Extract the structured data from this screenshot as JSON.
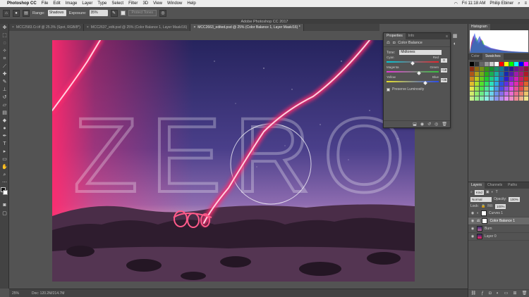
{
  "menubar": {
    "app_name": "Photoshop CC",
    "items": [
      "File",
      "Edit",
      "Image",
      "Layer",
      "Type",
      "Select",
      "Filter",
      "3D",
      "View",
      "Window",
      "Help"
    ],
    "clock": "Fri 11:18 AM",
    "user": "Philip Ebiner"
  },
  "options": {
    "range_label": "Range:",
    "range_value": "Shadows",
    "exposure_label": "Exposure:",
    "exposure_value": "35%",
    "protect_tones_label": "Protect Tones"
  },
  "window": {
    "title": "Adobe Photoshop CC 2017"
  },
  "doc_tabs": [
    {
      "label": "MCC2583.Cr.tif @ 25.3% (Spot, RGB/8*)",
      "active": false
    },
    {
      "label": "MCC2637_edit.psd @ 25% (Color Balance 1, Layer Mask/16)",
      "active": false
    },
    {
      "label": "MCC2663_edited.psd @ 25% (Color Balance 1, Layer Mask/16) *",
      "active": true
    }
  ],
  "status": {
    "zoom": "25%",
    "doc": "Doc: 120.2M/214.7M"
  },
  "canvas": {
    "overlay_text": "ZERO"
  },
  "properties": {
    "tabs": [
      "Properties",
      "Info"
    ],
    "title": "Color Balance",
    "tone_label": "Tone:",
    "tone_value": "Midtones",
    "sliders": [
      {
        "left": "Cyan",
        "right": "Red",
        "value": "0",
        "pos": 0.5,
        "gradient": [
          "#00c8d6",
          "#e8232a"
        ]
      },
      {
        "left": "Magenta",
        "right": "Green",
        "value": "+18",
        "pos": 0.62,
        "gradient": [
          "#e635d8",
          "#33c43a"
        ]
      },
      {
        "left": "Yellow",
        "right": "Blue",
        "value": "+35",
        "pos": 0.74,
        "gradient": [
          "#e8e02a",
          "#2a4be8"
        ]
      }
    ],
    "preserve_label": "Preserve Luminosity"
  },
  "histogram": {
    "title": "Histogram"
  },
  "swatches": {
    "tabs": [
      "Color",
      "Swatches"
    ]
  },
  "layers": {
    "tabs": [
      "Layers",
      "Channels",
      "Paths"
    ],
    "kind_label": "Kind",
    "blend_mode": "Normal",
    "opacity_label": "Opacity:",
    "opacity_value": "100%",
    "lock_label": "Lock:",
    "fill_label": "Fill:",
    "fill_value": "100%",
    "items": [
      {
        "name": "Curves 1",
        "type": "adjustment",
        "selected": false
      },
      {
        "name": "Color Balance 1",
        "type": "adjustment",
        "selected": true
      },
      {
        "name": "Burn",
        "type": "pixel",
        "selected": false
      },
      {
        "name": "Layer 0",
        "type": "pixel",
        "selected": false
      }
    ]
  },
  "colors": {
    "accent_neon": "#ff2a6d",
    "sky_top": "#2a2a6a",
    "sky_mid": "#6a4a9a",
    "horizon": "#c88ab8",
    "ground": "#3a2a3a"
  }
}
